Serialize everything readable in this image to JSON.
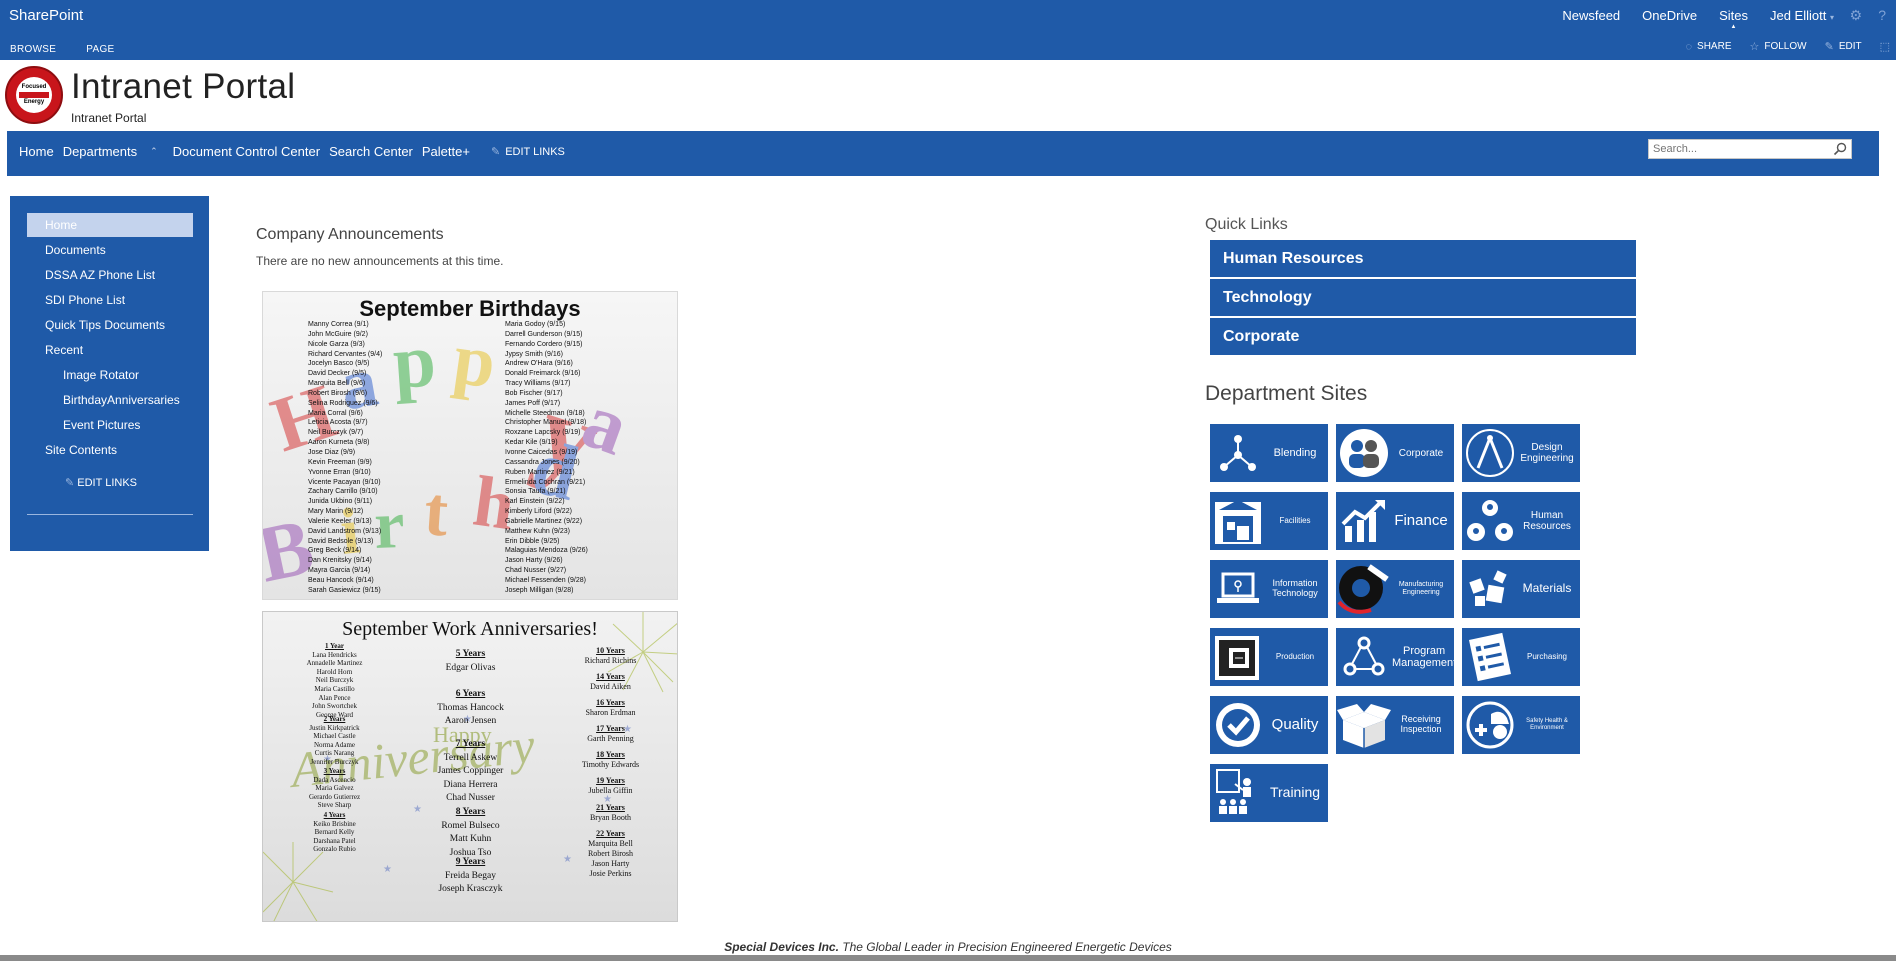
{
  "suite": {
    "brand": "SharePoint",
    "links": [
      "Newsfeed",
      "OneDrive",
      "Sites"
    ],
    "user": "Jed Elliott",
    "settings_icon": "gear-icon",
    "help_icon": "help-icon"
  },
  "ribbon": {
    "tabs": [
      "BROWSE",
      "PAGE"
    ],
    "actions": [
      "SHARE",
      "FOLLOW",
      "EDIT"
    ]
  },
  "site": {
    "title": "Intranet Portal",
    "subtitle": "Intranet Portal",
    "logo_text": [
      "Focused",
      "Energy"
    ]
  },
  "topnav": {
    "items": [
      "Home",
      "Departments",
      "Document Control Center",
      "Search Center",
      "Palette+"
    ],
    "edit_links": "EDIT LINKS",
    "search_placeholder": "Search..."
  },
  "leftnav": {
    "items": [
      "Home",
      "Documents",
      "DSSA AZ Phone List",
      "SDI Phone List",
      "Quick Tips Documents",
      "Recent",
      "Image Rotator",
      "BirthdayAnniversaries",
      "Event Pictures",
      "Site Contents"
    ],
    "edit_links": "EDIT LINKS"
  },
  "announcements": {
    "title": "Company Announcements",
    "message": "There are no new announcements at this time."
  },
  "birthdays": {
    "title": "September Birthdays",
    "banner": "Happy Birthday",
    "left": [
      "Manny Correa (9/1)",
      "John McGuire (9/2)",
      "Nicole Garza (9/3)",
      "Richard Cervantes (9/4)",
      "Jocelyn Basco (9/5)",
      "David Decker (9/5)",
      "Marquita Bell (9/6)",
      "Robert Birosh (9/6)",
      "Selina Rodriguez (9/6)",
      "Maria Corral (9/6)",
      "Leticia Acosta (9/7)",
      "Neil Burczyk (9/7)",
      "Aaron Kurneta (9/8)",
      "Jose Diaz (9/9)",
      "Kevin Freeman (9/9)",
      "Yvonne Erran (9/10)",
      "Vicente Pacayan (9/10)",
      "Zachary Carrillo (9/10)",
      "Junida Ukbino (9/11)",
      "Mary Marin (9/12)",
      "Valerie Keeler (9/13)",
      "David Landstrom (9/13)",
      "David Bedsole (9/13)",
      "Greg Beck (9/14)",
      "Dan Krenitsky (9/14)",
      "Mayra Garcia (9/14)",
      "Beau Hancock (9/14)",
      "Sarah Gasiewicz (9/15)"
    ],
    "right": [
      "Maria Godoy (9/15)",
      "Darrell Gunderson (9/15)",
      "Fernando Cordero (9/15)",
      "Jypsy Smith (9/16)",
      "Andrew O'Hara (9/16)",
      "Donald Freimarck (9/16)",
      "Tracy Williams (9/17)",
      "Bob Fischer (9/17)",
      "James Poff (9/17)",
      "Michelle Steedman (9/18)",
      "Christopher Manuel (9/18)",
      "Roxzane Lapcsky (9/19)",
      "Kedar Kile (9/19)",
      "Ivonne Caicedas (9/19)",
      "Cassandra Jones (9/20)",
      "Ruben Martinez (9/21)",
      "Ermelinda Cochran (9/21)",
      "Sonsia Taufa (9/21)",
      "Karl Einstein (9/22)",
      "Kimberly Liford (9/22)",
      "Gabrielle Martinez (9/22)",
      "Matthew Kuhn (9/23)",
      "Erin Dibble (9/25)",
      "Malaguias Mendoza (9/26)",
      "Jason Harty (9/26)",
      "Chad Nusser (9/27)",
      "Michael Fessenden (9/28)",
      "Joseph Milligan (9/28)"
    ]
  },
  "anniversaries": {
    "title": "September Work Anniversaries!",
    "banner": [
      "Happy",
      "Anniversary"
    ],
    "col1": [
      {
        "h": "1 Year",
        "names": [
          "Lana Hendricks",
          "Annadelle Martinez",
          "Harold Horn",
          "Neil Burczyk",
          "Maria Castillo",
          "Alan Pence",
          "John Swortchek",
          "George Ward"
        ]
      },
      {
        "h": "2 Years",
        "names": [
          "Justin Kirkpatrick",
          "Michael Castle",
          "Norma Adame",
          "Curtis Narang",
          "Jennifer Burczyk"
        ]
      },
      {
        "h": "3 Years",
        "names": [
          "Dada Ascencio",
          "Maria Galvez",
          "Gerardo Gutierrez",
          "Steve Sharp"
        ]
      },
      {
        "h": "4 Years",
        "names": [
          "Keiko Brisbine",
          "Bernard Kelly",
          "Darshana Patel",
          "Gonzalo Rubio"
        ]
      }
    ],
    "col2": [
      {
        "h": "5 Years",
        "names": [
          "Edgar Olivas"
        ]
      },
      {
        "h": "6 Years",
        "names": [
          "Thomas Hancock",
          "Aaron Jensen"
        ]
      },
      {
        "h": "7 Years",
        "names": [
          "Terrell Askew",
          "James Coppinger",
          "Diana Herrera",
          "Chad Nusser"
        ]
      },
      {
        "h": "8 Years",
        "names": [
          "Romel Bulseco",
          "Matt Kuhn",
          "Joshua Tso"
        ]
      },
      {
        "h": "9 Years",
        "names": [
          "Freida Begay",
          "Joseph Krasczyk"
        ]
      }
    ],
    "col3": [
      {
        "h": "10 Years",
        "names": [
          "Richard Richins"
        ]
      },
      {
        "h": "14 Years",
        "names": [
          "David Aiken"
        ]
      },
      {
        "h": "16 Years",
        "names": [
          "Sharon Erdman"
        ]
      },
      {
        "h": "17 Years",
        "names": [
          "Garth Penning"
        ]
      },
      {
        "h": "18 Years",
        "names": [
          "Timothy Edwards"
        ]
      },
      {
        "h": "19 Years",
        "names": [
          "Jubella Giffin"
        ]
      },
      {
        "h": "21 Years",
        "names": [
          "Bryan Booth"
        ]
      },
      {
        "h": "22 Years",
        "names": [
          "Marquita Bell",
          "Robert Birosh",
          "Jason Harty",
          "Josie Perkins"
        ]
      }
    ]
  },
  "quick_links": {
    "title": "Quick Links",
    "items": [
      "Human Resources",
      "Technology",
      "Corporate"
    ]
  },
  "dept_sites": {
    "title": "Department Sites",
    "tiles": [
      {
        "label": "Blending",
        "icon": "blending-network-icon"
      },
      {
        "label": "Corporate",
        "icon": "people-group-icon"
      },
      {
        "label": "Design Engineering",
        "icon": "drafting-compass-icon"
      },
      {
        "label": "Facilities",
        "icon": "warehouse-icon"
      },
      {
        "label": "Finance",
        "icon": "growth-chart-icon"
      },
      {
        "label": "Human Resources",
        "icon": "team-people-icon"
      },
      {
        "label": "Information Technology",
        "icon": "laptop-icon"
      },
      {
        "label": "Manufacturing Engineering",
        "icon": "gear-wrench-icon"
      },
      {
        "label": "Materials",
        "icon": "boxes-icon"
      },
      {
        "label": "Production",
        "icon": "machine-icon"
      },
      {
        "label": "Program Management",
        "icon": "project-network-icon"
      },
      {
        "label": "Purchasing",
        "icon": "checklist-icon"
      },
      {
        "label": "Quality",
        "icon": "quality-check-icon"
      },
      {
        "label": "Receiving Inspection",
        "icon": "open-box-icon"
      },
      {
        "label": "Safety Health & Environment",
        "icon": "safety-helmet-icon"
      },
      {
        "label": "Training",
        "icon": "presentation-icon"
      }
    ]
  },
  "footer": {
    "company": "Special Devices Inc.",
    "tagline": "The Global Leader in Precision Engineered Energetic Devices"
  }
}
